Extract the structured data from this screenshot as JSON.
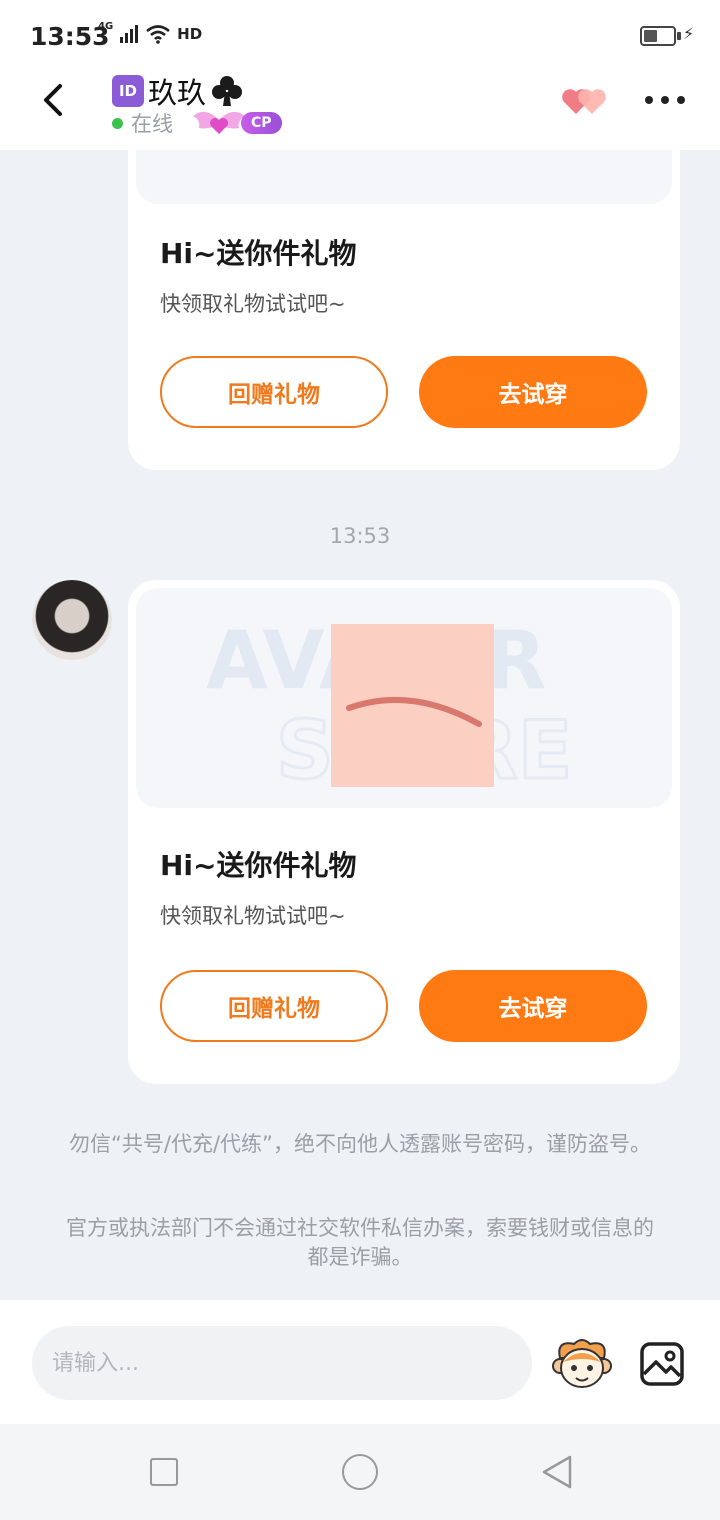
{
  "status_bar": {
    "time": "13:53",
    "network": "4G",
    "hd": "HD",
    "battery_level": 0.45
  },
  "header": {
    "id_badge": "ID",
    "title": "玖玖",
    "status": "在线",
    "cp_badge": "CP"
  },
  "chat": {
    "cards": [
      {
        "title": "Hi~送你件礼物",
        "subtitle": "快领取礼物试试吧~",
        "button_return": "回赠礼物",
        "button_try": "去试穿"
      },
      {
        "title": "Hi~送你件礼物",
        "subtitle": "快领取礼物试试吧~",
        "button_return": "回赠礼物",
        "button_try": "去试穿"
      }
    ],
    "timestamp": "13:53",
    "warnings": [
      "勿信“共号/代充/代练”，绝不向他人透露账号密码，谨防盗号。",
      "官方或执法部门不会通过社交软件私信办案，索要钱财或信息的都是诈骗。"
    ]
  },
  "input_bar": {
    "placeholder": "请输入..."
  },
  "icons": {
    "back": "back-arrow-icon",
    "club": "club-suit-icon",
    "hearts": "hearts-icon",
    "more": "more-icon",
    "emoji": "monkey-emoji-icon",
    "image": "image-icon"
  },
  "colors": {
    "accent": "#ff7a12",
    "online": "#3bc24f",
    "cp": "#b055de"
  }
}
